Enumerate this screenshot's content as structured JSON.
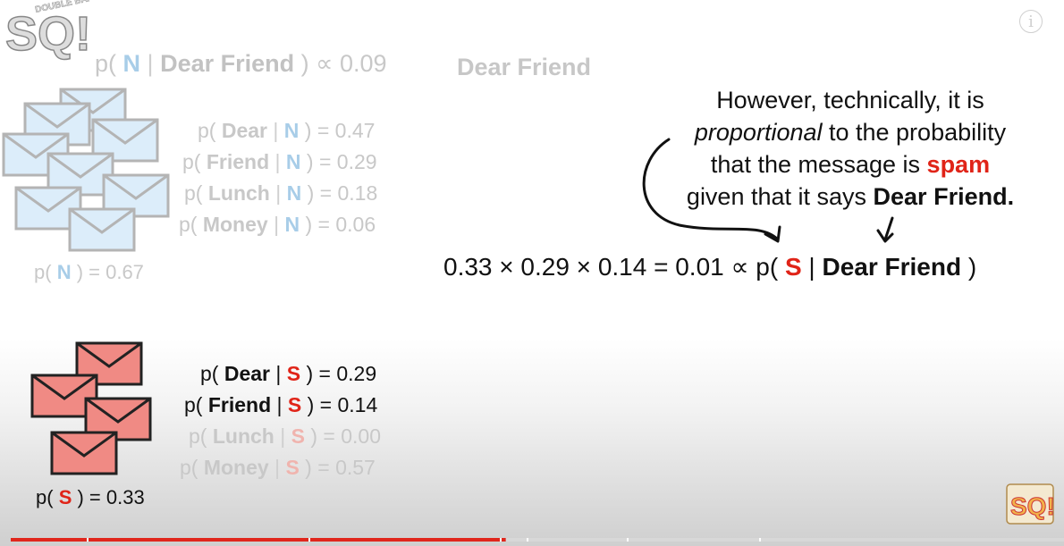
{
  "header": {
    "prefix": "p(",
    "n": "N",
    "bar": "|",
    "given": "Dear Friend",
    "suffix": ")",
    "prop_value": "∝ 0.09",
    "title_right": "Dear Friend"
  },
  "logo": {
    "text": "SQ!",
    "sub": "DOUBLE BAM!!!"
  },
  "normal": {
    "rows": [
      {
        "word": "Dear",
        "cls": "N",
        "value": "0.47"
      },
      {
        "word": "Friend",
        "cls": "N",
        "value": "0.29"
      },
      {
        "word": "Lunch",
        "cls": "N",
        "value": "0.18"
      },
      {
        "word": "Money",
        "cls": "N",
        "value": "0.06"
      }
    ],
    "prior_label": "N",
    "prior_value": "0.67"
  },
  "spam": {
    "rows": [
      {
        "word": "Dear",
        "cls": "S",
        "value": "0.29"
      },
      {
        "word": "Friend",
        "cls": "S",
        "value": "0.14"
      },
      {
        "word": "Lunch",
        "cls": "S",
        "value": "0.00"
      },
      {
        "word": "Money",
        "cls": "S",
        "value": "0.57"
      }
    ],
    "prior_label": "S",
    "prior_value": "0.33"
  },
  "note": {
    "line1": "However, technically, it is",
    "line2_em": "proportional",
    "line2_rest": " to the probability",
    "line3_pre": "that the message is ",
    "line3_spam": "spam",
    "line4_pre": "given that it says ",
    "line4_bold": "Dear Friend."
  },
  "main_eq": {
    "lhs": "0.33 × 0.29 × 0.14 = 0.01 ∝ p(",
    "s": "S",
    "bar": "|",
    "given": "Dear Friend",
    "close": ")"
  },
  "info_icon": "i",
  "colors": {
    "spam_red": "#e02418",
    "normal_blue": "#a8cde8",
    "envelope_red": "#f08a84",
    "envelope_blue": "#dcedfa",
    "progress_red": "#e0261c"
  },
  "progress": {
    "played_fraction": 0.47
  }
}
